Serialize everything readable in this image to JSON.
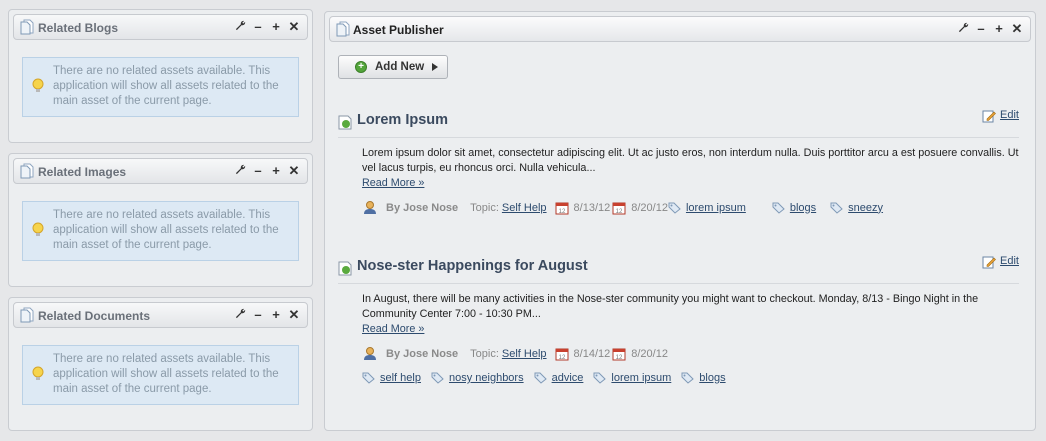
{
  "left_portlets": [
    {
      "title": "Related Blogs",
      "message": "There are no related assets available. This application will show all assets related to the main asset of the current page."
    },
    {
      "title": "Related Images",
      "message": "There are no related assets available. This application will show all assets related to the main asset of the current page."
    },
    {
      "title": "Related Documents",
      "message": "There are no related assets available. This application will show all assets related to the main asset of the current page."
    }
  ],
  "portlet_tools": {
    "config": "⚙",
    "minimize": "–",
    "maximize": "+",
    "close": "✕"
  },
  "asset_publisher": {
    "title": "Asset Publisher",
    "add_new_label": "Add New",
    "edit_label": "Edit",
    "read_more_label": "Read More »",
    "topic_label": "Topic:",
    "entries": [
      {
        "title": "Lorem Ipsum",
        "summary": "Lorem ipsum dolor sit amet, consectetur adipiscing elit. Ut ac justo eros, non interdum nulla. Duis porttitor arcu a est posuere convallis. Ut vel lacus turpis, eu rhoncus orci. Nulla vehicula...",
        "author": "By Jose Nose",
        "topic": "Self Help",
        "date_start": "8/13/12",
        "date_end": "8/20/12",
        "tags": [
          "lorem ipsum",
          "blogs",
          "sneezy"
        ]
      },
      {
        "title": "Nose-ster Happenings for August",
        "summary": "In August, there will be many activities in the Nose-ster community you might want to checkout.    Monday, 8/13 - Bingo Night in the Community Center 7:00 - 10:30 PM...",
        "author": "By Jose Nose",
        "topic": "Self Help",
        "date_start": "8/14/12",
        "date_end": "8/20/12",
        "tags": [
          "self help",
          "nosy neighbors",
          "advice",
          "lorem ipsum",
          "blogs"
        ]
      }
    ]
  },
  "colors": {
    "accent_link": "#2d4b6e",
    "info_bg": "#dde9f4",
    "add_icon": "#53a53b"
  }
}
